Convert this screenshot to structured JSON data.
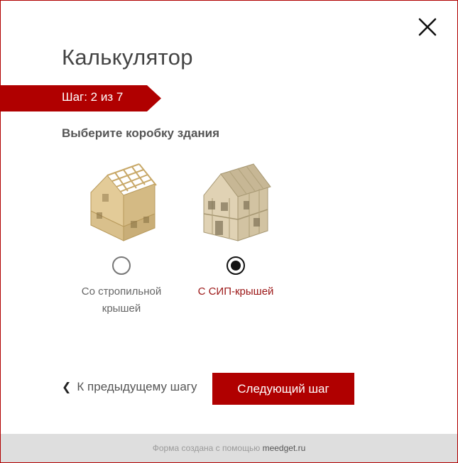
{
  "modal": {
    "title": "Калькулятор",
    "step": "Шаг: 2 из 7",
    "question": "Выберите коробку здания"
  },
  "options": [
    {
      "label": "Со стропильной крышей",
      "selected": false,
      "image": "house-rafter-roof-image"
    },
    {
      "label": "С СИП-крышей",
      "selected": true,
      "image": "house-sip-roof-image"
    }
  ],
  "navigation": {
    "prev_arrow": "❮",
    "prev_label": "К предыдущему шагу",
    "next_label": "Следующий шаг"
  },
  "footer": {
    "text": "Форма создана с помощью",
    "brand": "meedget.ru"
  },
  "colors": {
    "accent": "#b00000",
    "selected_label": "#9b1515",
    "footer_bg": "#dedede"
  },
  "icons": {
    "close": "close-icon"
  }
}
